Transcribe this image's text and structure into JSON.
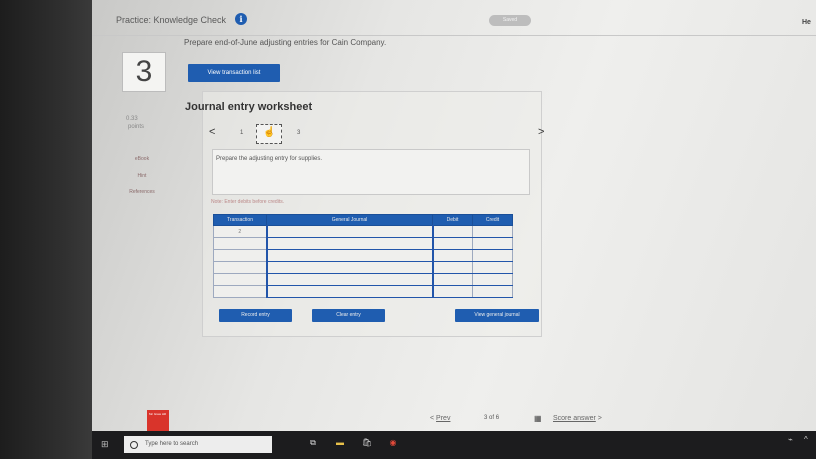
{
  "header": {
    "title": "Practice: Knowledge Check",
    "info_icon": "i",
    "saved_label": "Saved",
    "help_label": "He"
  },
  "prompt_text": "Prepare end-of-June adjusting entries for Cain Company.",
  "question": {
    "number": "3",
    "points_value": "0.33",
    "points_label": "points"
  },
  "sidebar": {
    "links": [
      "eBook",
      "Hint",
      "References"
    ]
  },
  "buttons": {
    "view_transaction_list": "View transaction list",
    "record_entry": "Record entry",
    "clear_entry": "Clear entry",
    "view_general_journal": "View general journal"
  },
  "worksheet": {
    "title": "Journal entry worksheet",
    "pagination": {
      "prev": "<",
      "next": ">",
      "pages": [
        "1",
        "2",
        "3"
      ],
      "current_index": 1
    },
    "instruction": "Prepare the adjusting entry for supplies.",
    "note": "Note: Enter debits before credits.",
    "table": {
      "headers": [
        "Transaction",
        "General Journal",
        "Debit",
        "Credit"
      ],
      "rows": [
        [
          "2",
          "",
          "",
          ""
        ],
        [
          "",
          "",
          "",
          ""
        ],
        [
          "",
          "",
          "",
          ""
        ],
        [
          "",
          "",
          "",
          ""
        ],
        [
          "",
          "",
          "",
          ""
        ],
        [
          "",
          "",
          "",
          ""
        ]
      ]
    }
  },
  "footer_nav": {
    "prev_arrow": "<",
    "prev_label": "Prev",
    "current_page": "3",
    "of_label": "of",
    "total_pages": "6",
    "score_label": "Score answer",
    "score_arrow": ">"
  },
  "logo_text": "Mc Graw Hill",
  "taskbar": {
    "search_placeholder": "Type here to search",
    "icons": [
      "windows-icon",
      "task-view-icon",
      "file-explorer-icon",
      "store-icon",
      "chrome-icon"
    ]
  },
  "colors": {
    "accent": "#1f5db0",
    "logo": "#d9342b",
    "taskbar": "#1c1c1e"
  }
}
